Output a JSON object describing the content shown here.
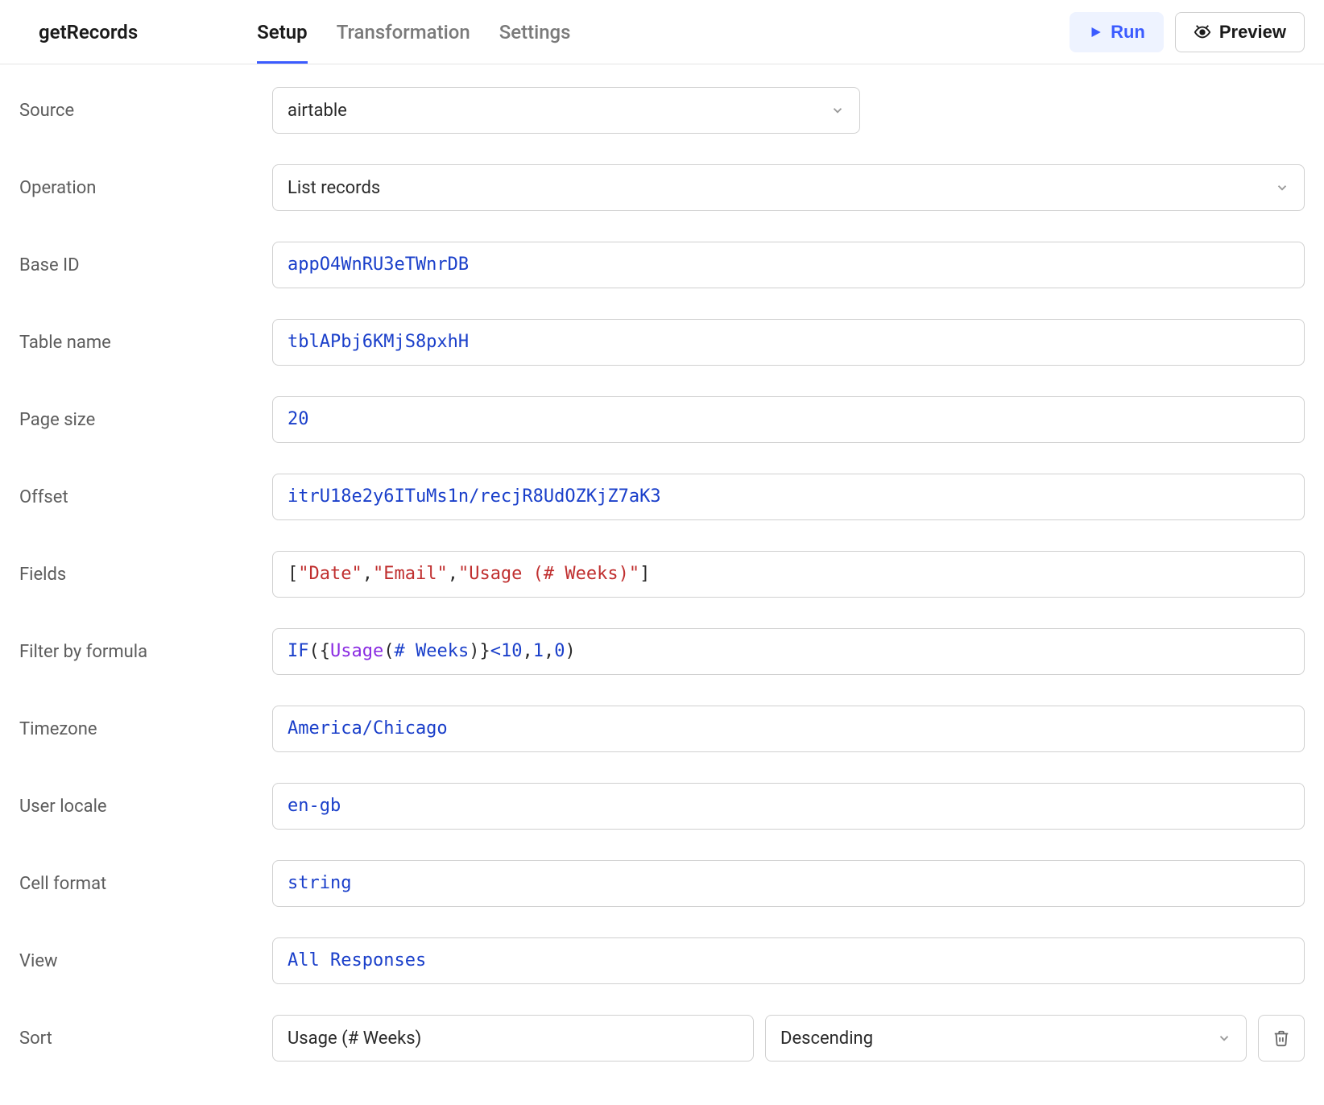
{
  "header": {
    "title": "getRecords",
    "tabs": [
      {
        "label": "Setup",
        "active": true
      },
      {
        "label": "Transformation",
        "active": false
      },
      {
        "label": "Settings",
        "active": false
      }
    ],
    "run_label": "Run",
    "preview_label": "Preview"
  },
  "form": {
    "source": {
      "label": "Source",
      "value": "airtable"
    },
    "operation": {
      "label": "Operation",
      "value": "List records"
    },
    "base_id": {
      "label": "Base ID",
      "value": "appO4WnRU3eTWnrDB"
    },
    "table_name": {
      "label": "Table name",
      "value": "tblAPbj6KMjS8pxhH"
    },
    "page_size": {
      "label": "Page size",
      "value": "20"
    },
    "offset": {
      "label": "Offset",
      "value": "itrU18e2y6ITuMs1n/recjR8UdOZKjZ7aK3"
    },
    "fields": {
      "label": "Fields",
      "value_raw": "[\"Date\", \"Email\", \"Usage (# Weeks)\"]"
    },
    "filter": {
      "label": "Filter by formula",
      "value_raw": "IF({Usage (# Weeks)} < 10, 1, 0)"
    },
    "timezone": {
      "label": "Timezone",
      "value": "America/Chicago"
    },
    "user_locale": {
      "label": "User locale",
      "value": "en-gb"
    },
    "cell_format": {
      "label": "Cell format",
      "value": "string"
    },
    "view": {
      "label": "View",
      "value": "All Responses"
    },
    "sort": {
      "label": "Sort",
      "field": "Usage (# Weeks)",
      "direction": "Descending"
    }
  },
  "colors": {
    "accent": "#3b5bff",
    "code_blue": "#1a3fca",
    "code_purple": "#8a2be2",
    "border": "#d0d0d0"
  }
}
